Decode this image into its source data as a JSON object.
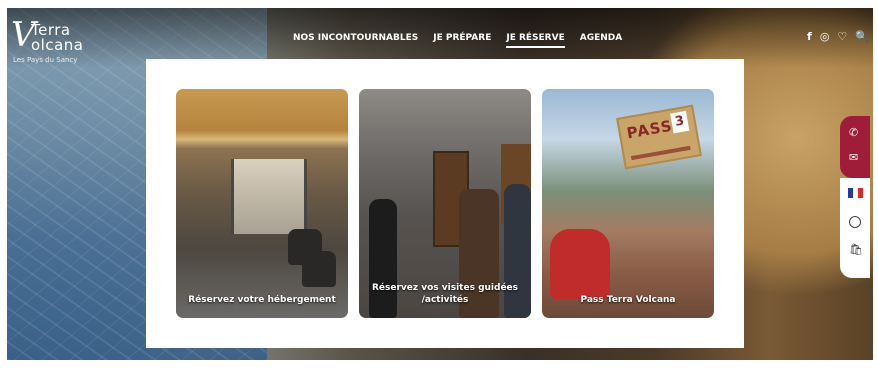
{
  "logo": {
    "mark": "V",
    "line1": "Terra",
    "line2": "olcana",
    "subtitle": "Les Pays du Sancy"
  },
  "nav": {
    "items": [
      {
        "label": "NOS INCONTOURNABLES"
      },
      {
        "label": "JE PRÉPARE"
      },
      {
        "label": "JE RÉSERVE",
        "active": true
      },
      {
        "label": "AGENDA"
      }
    ]
  },
  "social": {
    "facebook": "f",
    "instagram": "◎",
    "heart": "♡",
    "search": "🔍"
  },
  "cards": [
    {
      "title": "Réservez votre hébergement"
    },
    {
      "title": "Réservez vos visites guidées /activités"
    },
    {
      "title": "Pass Terra Volcana",
      "tag_text": "PASS",
      "tag_num": "3"
    }
  ],
  "side": {
    "phone": "✆",
    "mail": "✉",
    "sun": "☼",
    "bag": "🛍"
  },
  "colors": {
    "accent": "#a01d3a",
    "panel": "#ffffff"
  }
}
